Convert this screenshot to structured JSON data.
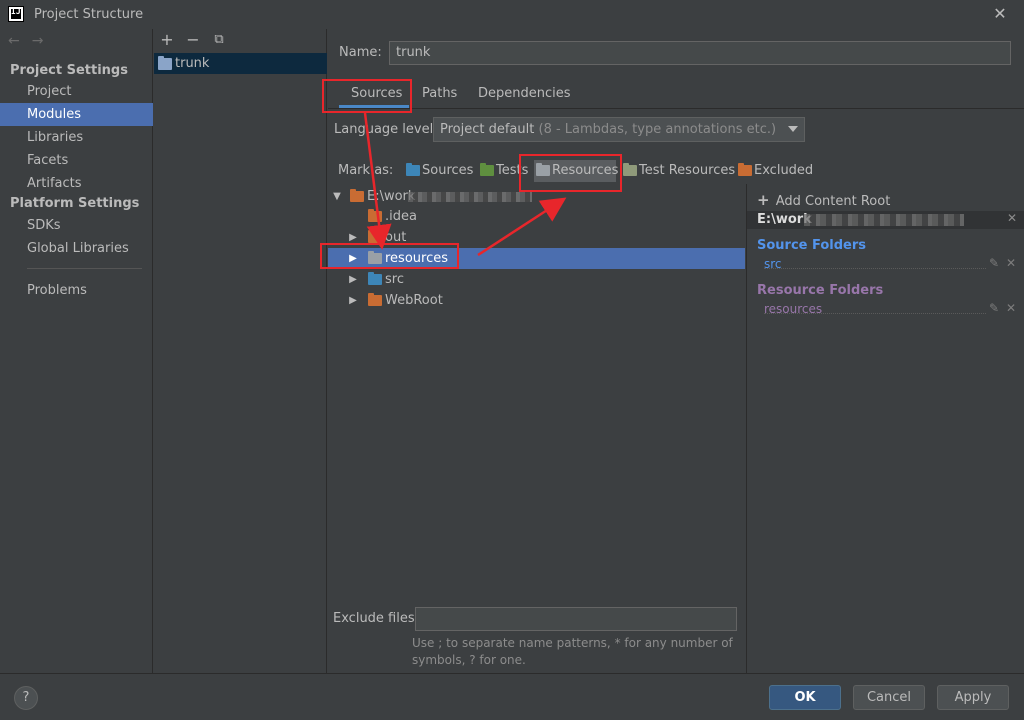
{
  "window": {
    "title": "Project Structure",
    "logo_text": "IJ",
    "close": "✕"
  },
  "nav": {
    "back": "←",
    "forward": "→",
    "project_settings": "Project Settings",
    "platform_settings": "Platform Settings",
    "items": {
      "project": "Project",
      "modules": "Modules",
      "libraries": "Libraries",
      "facets": "Facets",
      "artifacts": "Artifacts",
      "sdks": "SDKs",
      "global_libraries": "Global Libraries",
      "problems": "Problems"
    }
  },
  "modules": {
    "add": "+",
    "remove": "−",
    "copy": "⧉",
    "selected": "trunk"
  },
  "main": {
    "name_label": "Name:",
    "name_value": "trunk",
    "tabs": {
      "sources": "Sources",
      "paths": "Paths",
      "dependencies": "Dependencies"
    },
    "language_level_label": "Language level:",
    "language_level_value": "Project default",
    "language_level_sub": "(8 - Lambdas, type annotations etc.)",
    "mark_as_label": "Mark as:",
    "mark_as": {
      "sources": "Sources",
      "tests": "Tests",
      "resources": "Resources",
      "test_resources": "Test Resources",
      "excluded": "Excluded"
    },
    "tree": {
      "root": "E:\\work",
      "items": {
        "idea": ".idea",
        "out": "out",
        "resources": "resources",
        "src": "src",
        "webroot": "WebRoot"
      }
    },
    "exclude_label": "Exclude files:",
    "exclude_value": "",
    "exclude_hint": "Use ; to separate name patterns, * for any number of symbols, ? for one."
  },
  "content_root": {
    "add_label": "Add Content Root",
    "path": "E:\\work",
    "source_folders_title": "Source Folders",
    "source_folders": [
      "src"
    ],
    "resource_folders_title": "Resource Folders",
    "resource_folders": [
      "resources"
    ]
  },
  "buttons": {
    "help": "?",
    "ok": "OK",
    "cancel": "Cancel",
    "apply": "Apply"
  },
  "colors": {
    "background": "#3c3f41",
    "selection": "#4b6eaf",
    "source_folder": "#5394ec",
    "resource_folder": "#9876aa",
    "annotation_red": "#e8262b",
    "excluded_folder": "#c96c33"
  },
  "icons": [
    "search-icon",
    "plus-icon",
    "minus-icon",
    "copy-icon",
    "folder-icon",
    "close-icon",
    "edit-icon",
    "chevron-down-icon",
    "help-icon"
  ]
}
